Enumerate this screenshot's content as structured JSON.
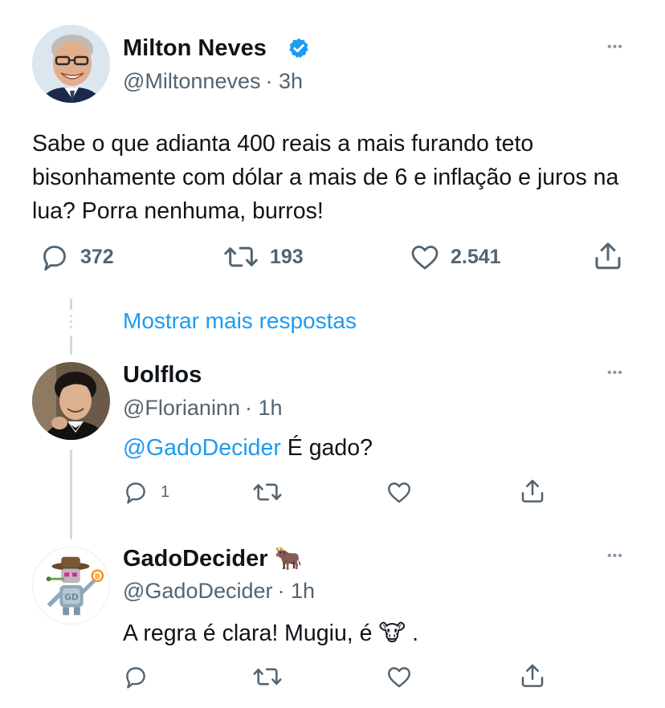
{
  "main_tweet": {
    "author_name": "Milton Neves",
    "handle": "@Miltonneves",
    "time": "· 3h",
    "text": "Sabe o que adianta 400 reais a mais furando teto bisonhamente com dólar a mais de 6 e inflação e juros na lua? Porra nenhuma, burros!",
    "replies": "372",
    "retweets": "193",
    "likes": "2.541",
    "more_label": "•••"
  },
  "show_more_replies": "Mostrar mais respostas",
  "reply_1": {
    "author_name": "Uolflos",
    "handle": "@Florianinn",
    "time": "· 1h",
    "mention": "@GadoDecider",
    "text": " É gado?",
    "replies": "1",
    "more_label": "•••"
  },
  "reply_2": {
    "author_name": "GadoDecider",
    "name_emoji": "🐂",
    "handle": "@GadoDecider",
    "time": "· 1h",
    "text_before": "A regra é clara! Mugiu, é ",
    "text_emoji": "🐮",
    "text_after": " .",
    "more_label": "•••"
  },
  "colors": {
    "link": "#1d9bf0",
    "verified": "#1d9bf0",
    "secondary_text": "#536471",
    "thread_line": "#cfd9de"
  },
  "icons": {
    "reply": "speech-bubble-icon",
    "retweet": "retweet-arrows-icon",
    "like": "heart-icon",
    "share": "share-upload-icon",
    "verified": "verified-badge-icon",
    "more": "ellipsis-icon"
  }
}
